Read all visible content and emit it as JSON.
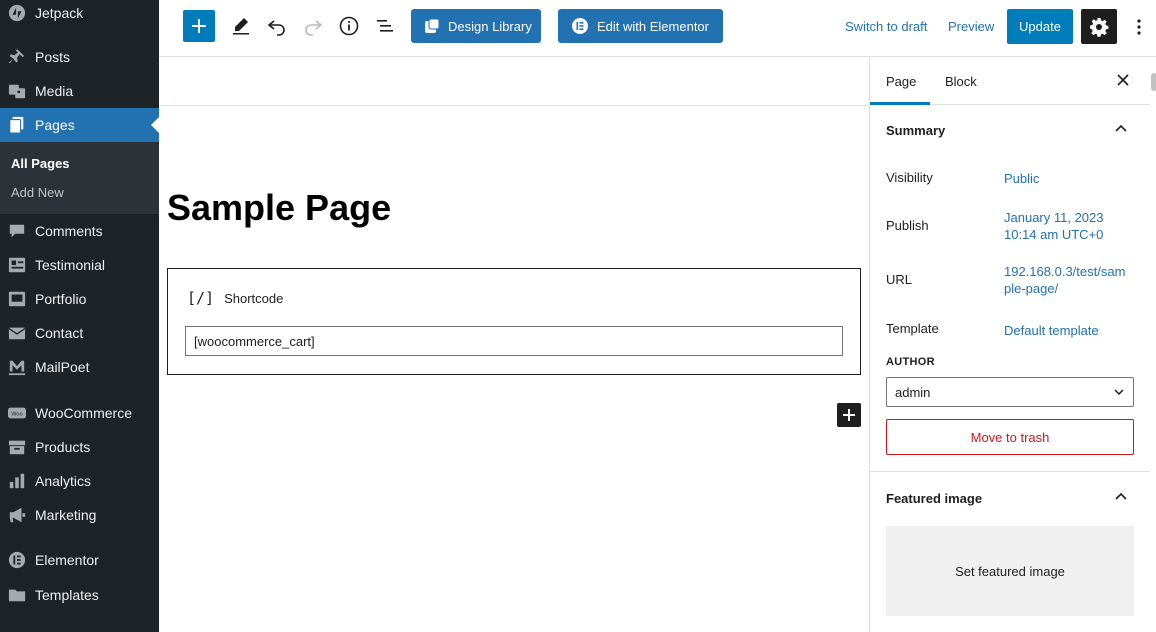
{
  "sidebar": {
    "items": [
      {
        "label": "Jetpack",
        "icon": "jetpack-icon"
      },
      {
        "label": "Posts",
        "icon": "pushpin-icon"
      },
      {
        "label": "Media",
        "icon": "media-icon"
      },
      {
        "label": "Pages",
        "icon": "pages-icon"
      },
      {
        "label": "Comments",
        "icon": "comments-icon"
      },
      {
        "label": "Testimonial",
        "icon": "testimonial-icon"
      },
      {
        "label": "Portfolio",
        "icon": "portfolio-icon"
      },
      {
        "label": "Contact",
        "icon": "envelope-icon"
      },
      {
        "label": "MailPoet",
        "icon": "mailpoet-icon"
      },
      {
        "label": "WooCommerce",
        "icon": "woocommerce-icon"
      },
      {
        "label": "Products",
        "icon": "archive-icon"
      },
      {
        "label": "Analytics",
        "icon": "bar-chart-icon"
      },
      {
        "label": "Marketing",
        "icon": "megaphone-icon"
      },
      {
        "label": "Elementor",
        "icon": "elementor-icon"
      },
      {
        "label": "Templates",
        "icon": "folder-icon"
      }
    ],
    "submenu": {
      "all_pages": "All Pages",
      "add_new": "Add New"
    },
    "active_item": "Pages"
  },
  "toolbar": {
    "design_library": "Design Library",
    "edit_with_elementor": "Edit with Elementor",
    "switch_to_draft": "Switch to draft",
    "preview": "Preview",
    "update": "Update"
  },
  "editor": {
    "page_title": "Sample Page",
    "shortcode_block": {
      "icon_text": "[/]",
      "label": "Shortcode",
      "value": "[woocommerce_cart]"
    }
  },
  "panel": {
    "tabs": {
      "page": "Page",
      "block": "Block"
    },
    "active_tab": "Page",
    "summary": {
      "title": "Summary",
      "visibility_label": "Visibility",
      "visibility_value": "Public",
      "publish_label": "Publish",
      "publish_date": "January 11, 2023",
      "publish_time": "10:14 am UTC+0",
      "url_label": "URL",
      "url_line1": "192.168.0.3/test/sam",
      "url_line2": "ple-page/",
      "template_label": "Template",
      "template_value": "Default template",
      "author_label": "AUTHOR",
      "author_value": "admin",
      "trash": "Move to trash"
    },
    "featured": {
      "title": "Featured image",
      "set_label": "Set featured image"
    }
  },
  "colors": {
    "sidebar_bg": "#1d2327",
    "accent": "#2271b1",
    "wp_blue": "#007cba",
    "danger": "#cc1818"
  }
}
